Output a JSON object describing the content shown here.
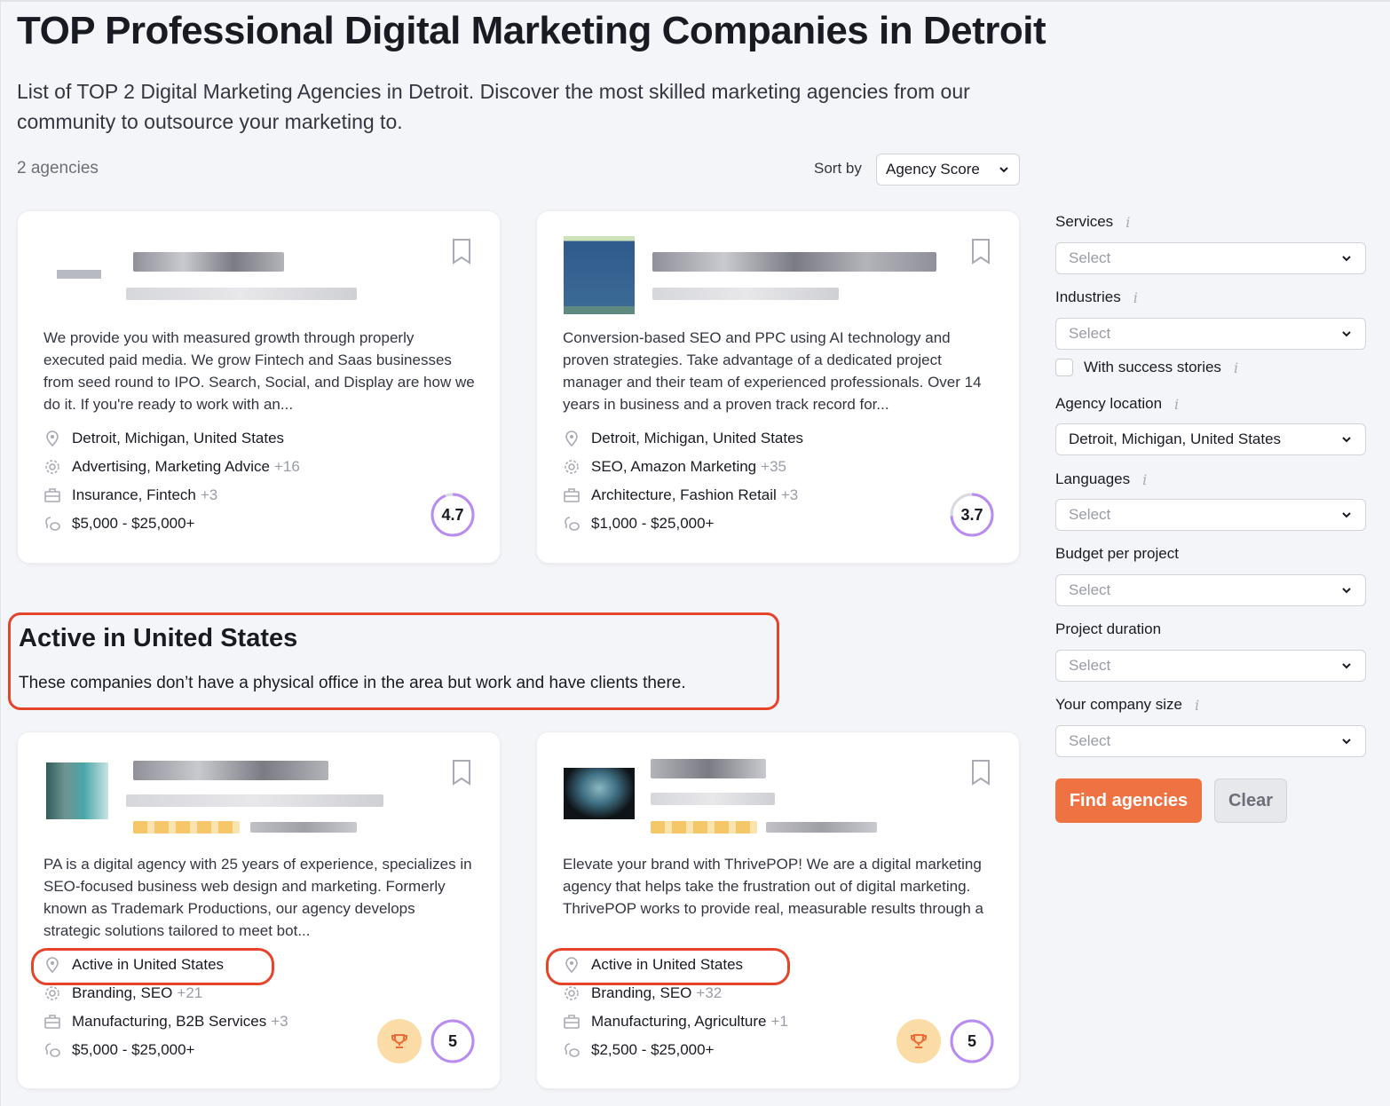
{
  "header": {
    "title": "TOP Professional Digital Marketing Companies in Detroit",
    "subtitle": "List of TOP 2 Digital Marketing Agencies in Detroit. Discover the most skilled marketing agencies from our community to outsource your marketing to.",
    "count": "2 agencies",
    "sort_label": "Sort by",
    "sort_value": "Agency Score"
  },
  "agencies": [
    {
      "description": "We provide you with measured growth through properly executed paid media. We grow Fintech and Saas businesses from seed round to IPO. Search, Social, and Display are how we do it. If you're ready to work with an...",
      "location": "Detroit, Michigan, United States",
      "services": "Advertising, Marketing Advice",
      "services_extra": "+16",
      "industries": "Insurance, Fintech",
      "industries_extra": "+3",
      "budget": "$5,000 - $25,000+",
      "score": "4.7",
      "score_fraction": 0.94
    },
    {
      "description": "Conversion-based SEO and PPC using AI technology and proven strategies. Take advantage of a dedicated project manager and their team of experienced professionals. Over 14 years in business and a proven track record for...",
      "location": "Detroit, Michigan, United States",
      "services": "SEO, Amazon Marketing",
      "services_extra": "+35",
      "industries": "Architecture, Fashion Retail",
      "industries_extra": "+3",
      "budget": "$1,000 - $25,000+",
      "score": "3.7",
      "score_fraction": 0.74
    }
  ],
  "active_section": {
    "title": "Active in United States",
    "description": "These companies don’t have a physical office in the area but work and have clients there."
  },
  "active_agencies": [
    {
      "description": "PA is a digital agency with 25 years of experience, specializes in SEO-focused business web design and marketing. Formerly known as Trademark Productions, our agency develops strategic solutions tailored to meet bot...",
      "location": "Active in United States",
      "services": "Branding, SEO",
      "services_extra": "+21",
      "industries": "Manufacturing, B2B Services",
      "industries_extra": "+3",
      "budget": "$5,000 - $25,000+",
      "score": "5",
      "score_fraction": 1.0
    },
    {
      "description": "Elevate your brand with ThrivePOP! We are a digital marketing agency that helps take the frustration out of digital marketing. ThrivePOP works to provide real, measurable results through a",
      "location": "Active in United States",
      "services": "Branding, SEO",
      "services_extra": "+32",
      "industries": "Manufacturing, Agriculture",
      "industries_extra": "+1",
      "budget": "$2,500 - $25,000+",
      "score": "5",
      "score_fraction": 1.0
    }
  ],
  "filters": {
    "services": {
      "label": "Services",
      "value": "Select"
    },
    "industries": {
      "label": "Industries",
      "value": "Select"
    },
    "success_stories": {
      "label": "With success stories",
      "checked": false
    },
    "agency_location": {
      "label": "Agency location",
      "value": "Detroit, Michigan, United States"
    },
    "languages": {
      "label": "Languages",
      "value": "Select"
    },
    "budget": {
      "label": "Budget per project",
      "value": "Select"
    },
    "duration": {
      "label": "Project duration",
      "value": "Select"
    },
    "company_size": {
      "label": "Your company size",
      "value": "Select"
    },
    "find_button": "Find agencies",
    "clear_button": "Clear"
  },
  "colors": {
    "accent": "#ef7242",
    "score_ring": "#b98cf2",
    "highlight": "#e5432a",
    "trophy_bg": "#fbdca6"
  }
}
